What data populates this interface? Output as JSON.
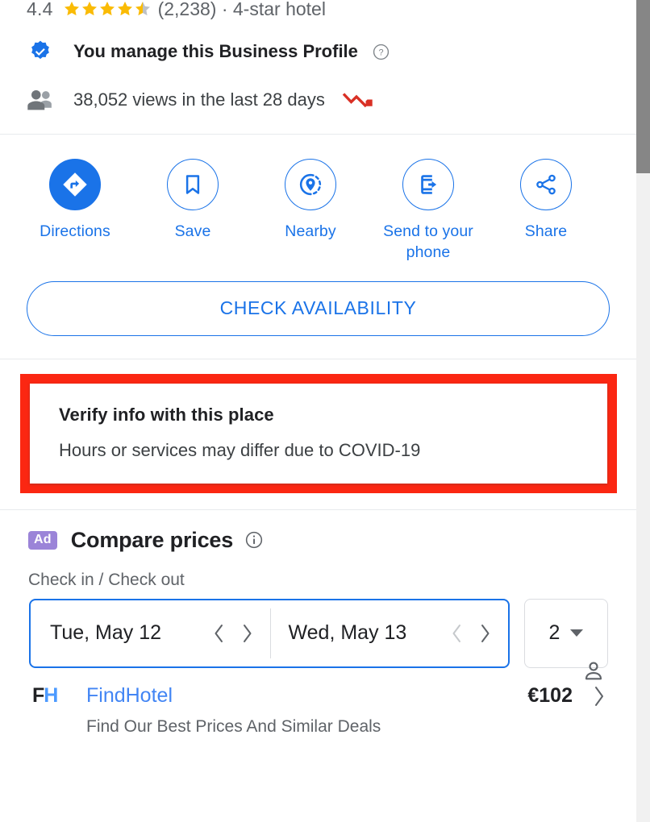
{
  "rating": {
    "value": "4.4",
    "stars_filled": 4,
    "stars_half": 1,
    "stars_total": 5,
    "count": "(2,238) · 4-star hotel",
    "star_color": "#fabb05",
    "star_empty_color": "#bdc1c6"
  },
  "manage": {
    "label": "You manage this Business Profile",
    "help_icon": "help-circle-icon",
    "badge_icon": "verified-badge-icon",
    "badge_color": "#1a73e8"
  },
  "views": {
    "label": "38,052 views in the last 28 days",
    "people_icon": "people-icon",
    "trend_icon": "trending-down-icon",
    "trend_color": "#d93025"
  },
  "actions": [
    {
      "label": "Directions",
      "icon": "directions-icon",
      "filled": true
    },
    {
      "label": "Save",
      "icon": "bookmark-icon",
      "filled": false
    },
    {
      "label": "Nearby",
      "icon": "nearby-pin-icon",
      "filled": false
    },
    {
      "label": "Send to your phone",
      "icon": "send-to-phone-icon",
      "filled": false
    },
    {
      "label": "Share",
      "icon": "share-icon",
      "filled": false
    }
  ],
  "check_availability": {
    "label": "CHECK AVAILABILITY",
    "accent": "#1a73e8"
  },
  "verify": {
    "title": "Verify info with this place",
    "subtitle": "Hours or services may differ due to COVID-19",
    "highlight_color": "#fb2712"
  },
  "compare": {
    "ad_badge": "Ad",
    "ad_badge_color": "#9b84d8",
    "title": "Compare prices",
    "info_icon": "info-circle-icon",
    "dates_label": "Check in / Check out",
    "guest_icon": "person-icon",
    "check_in": "Tue, May 12",
    "check_out": "Wed, May 13",
    "guests": "2",
    "prev_icon": "chevron-left-icon",
    "next_icon": "chevron-right-icon"
  },
  "providers": [
    {
      "logo_primary": "F",
      "logo_secondary": "H",
      "name": "FindHotel",
      "price": "€102",
      "subtitle": "Find Our Best Prices And Similar Deals",
      "chevron": "chevron-right-icon"
    }
  ],
  "scrollbar": {
    "thumb_color": "#868686"
  }
}
